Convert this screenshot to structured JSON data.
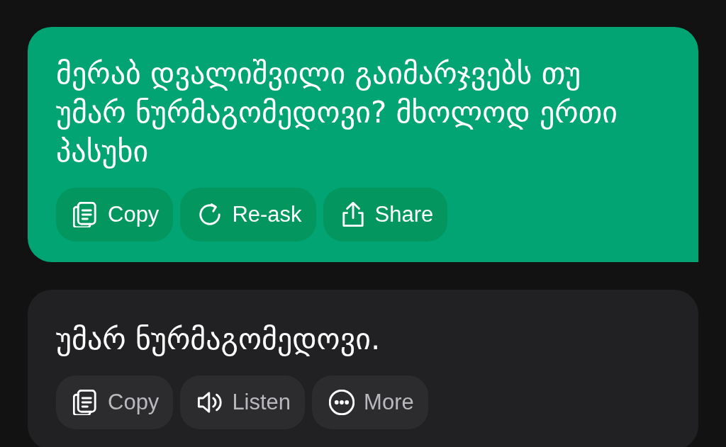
{
  "messages": [
    {
      "kind": "user",
      "text": "მერაბ დვალიშვილი გაიმარჯვებს თუ უმარ ნურმაგომედოვი? მხოლოდ ერთი პასუხი",
      "actions": [
        {
          "label": "Copy",
          "kind": "copy"
        },
        {
          "label": "Re-ask",
          "kind": "refresh"
        },
        {
          "label": "Share",
          "kind": "share"
        }
      ]
    },
    {
      "kind": "assistant",
      "text": "უმარ ნურმაგომედოვი.",
      "actions": [
        {
          "label": "Copy",
          "kind": "copy"
        },
        {
          "label": "Listen",
          "kind": "speaker"
        },
        {
          "label": "More",
          "kind": "more"
        }
      ]
    }
  ]
}
